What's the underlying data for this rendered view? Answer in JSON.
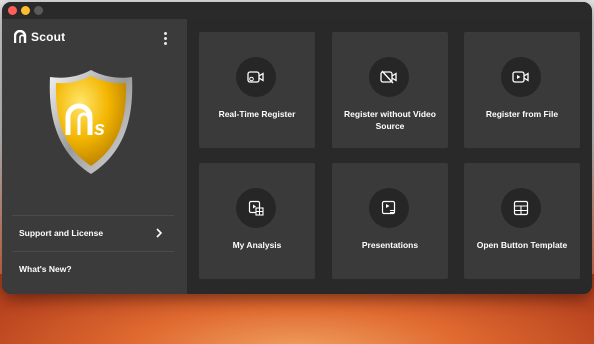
{
  "app": {
    "logo_text": "Scout"
  },
  "sidebar": {
    "items": [
      {
        "label": "Support and License"
      },
      {
        "label": "What's New?"
      }
    ]
  },
  "tiles": [
    {
      "label": "Real-Time Register",
      "icon": "camera-record-icon"
    },
    {
      "label": "Register without Video Source",
      "icon": "video-off-icon"
    },
    {
      "label": "Register from File",
      "icon": "video-file-icon"
    },
    {
      "label": "My Analysis",
      "icon": "analysis-icon"
    },
    {
      "label": "Presentations",
      "icon": "presentation-icon"
    },
    {
      "label": "Open Button Template",
      "icon": "grid-template-icon"
    }
  ],
  "colors": {
    "accent": "#f0b400",
    "window_bg": "#292929",
    "tile_bg": "#3a3a3a",
    "sidebar_bg": "#3b3b3b"
  }
}
